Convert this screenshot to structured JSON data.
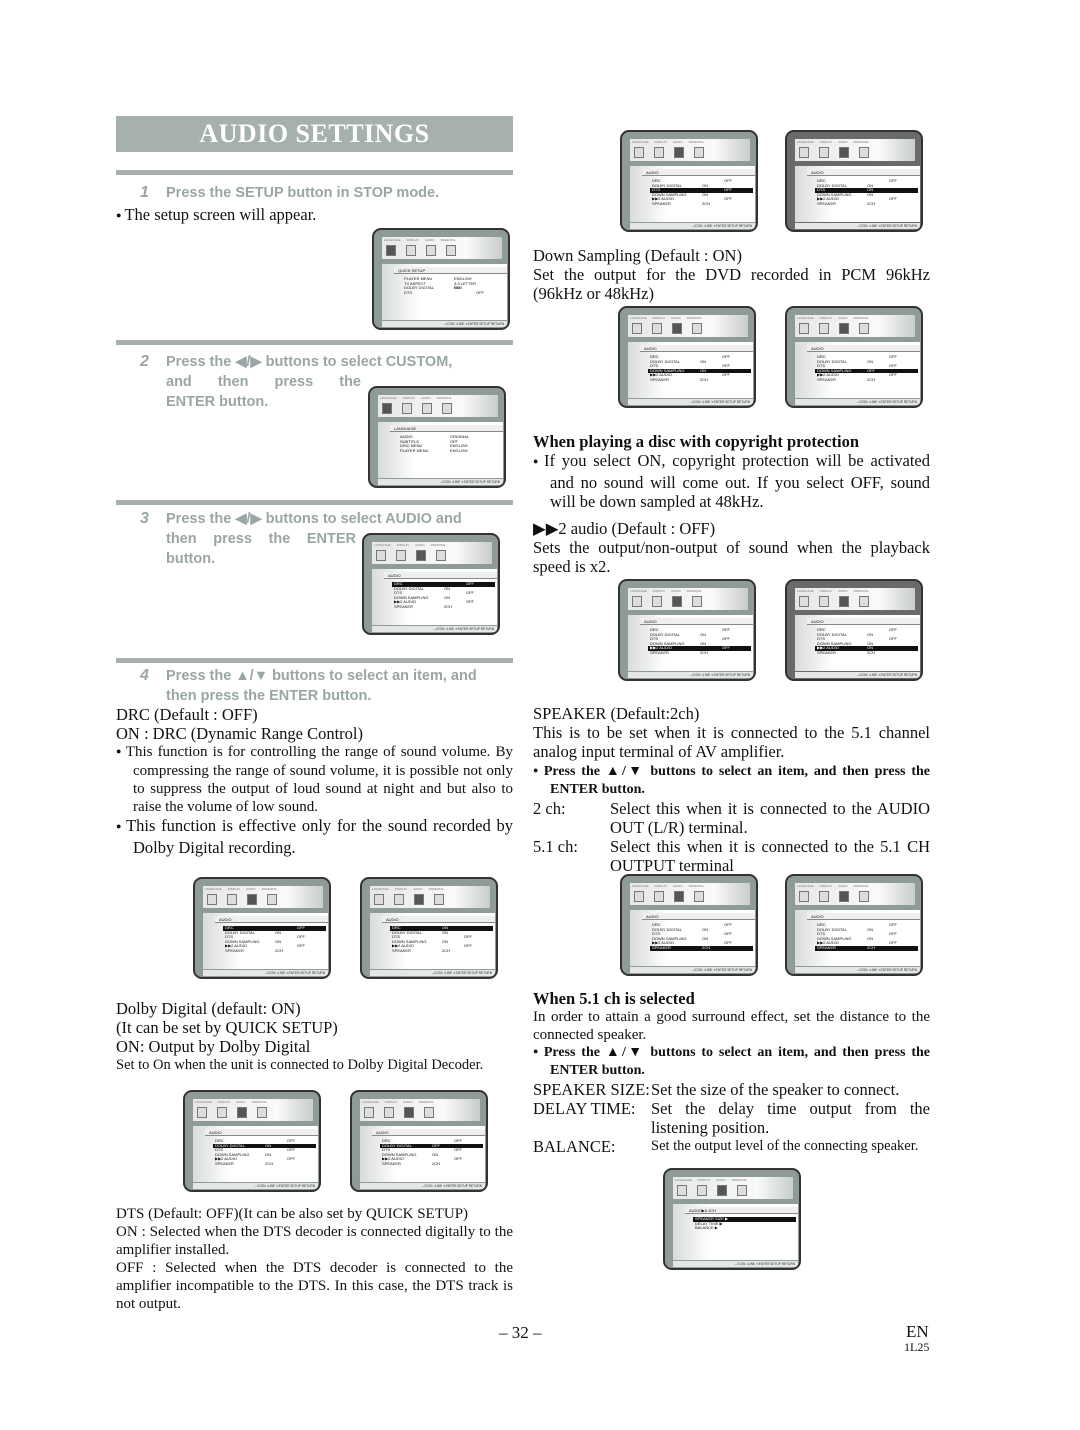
{
  "title": "AUDIO SETTINGS",
  "steps": [
    {
      "num": "1",
      "text": "Press the SETUP button in STOP mode."
    },
    {
      "num": "2",
      "line1": "Press the ◀/▶ buttons to select CUSTOM,",
      "line2": "and then press the",
      "line3": "ENTER button."
    },
    {
      "num": "3",
      "line1": "Press the ◀/▶ buttons to select AUDIO and",
      "line2": "then press the ENTER",
      "line3": "button."
    },
    {
      "num": "4",
      "line1": "Press the ▲/▼ buttons to select an item, and",
      "line2": "then press the ENTER button."
    }
  ],
  "left": {
    "setup_appear": "The setup screen will appear.",
    "drc_default": "DRC (Default : OFF)",
    "drc_on": "ON : DRC (Dynamic Range Control)",
    "drc_bullet1": "This function is for controlling the range of sound volume. By compressing the range of sound volume, it is possible not only to suppress the output of loud sound at night and but also to raise the volume of low sound.",
    "drc_bullet2": "This function is effective only for the sound recorded by Dolby Digital recording.",
    "dolby_default": "Dolby Digital (default: ON)",
    "dolby_quick": "(It can be set by QUICK SETUP)",
    "dolby_on": "ON: Output by Dolby Digital",
    "dolby_note": "Set to On when the unit is connected to Dolby Digital Decoder.",
    "dts_default": "DTS (Default: OFF)(It can be also set by QUICK SETUP)",
    "dts_on": "ON : Selected when the DTS decoder is connected digitally to the amplifier installed.",
    "dts_off": "OFF : Selected when the DTS decoder is connected to the amplifier incompatible to the DTS. In this case, the DTS track is not output."
  },
  "right": {
    "ds_default": "Down Sampling (Default : ON)",
    "ds_desc": "Set the output for the DVD recorded in PCM 96kHz (96kHz or 48kHz)",
    "copyright_head": "When playing a disc with copyright protection",
    "copyright_bullet": "If you select ON, copyright protection will be activated and no sound will come out. If you select OFF, sound will be down sampled at 48kHz.",
    "x2_default": "▶▶2 audio (Default : OFF)",
    "x2_desc": "Sets the output/non-output of sound when the playback speed is x2.",
    "speaker_default": "SPEAKER (Default:2ch)",
    "speaker_desc": "This is to be set when it is connected to the 5.1 channel analog input terminal of AV amplifier.",
    "speaker_bullet": "Press the ▲/▼ buttons to select an item, and then press the ENTER button.",
    "ch2_label": "2 ch:",
    "ch2_desc": "Select this when it is connected to the AUDIO OUT (L/R) terminal.",
    "ch51_label": "5.1 ch:",
    "ch51_desc": "Select this when it is connected to the 5.1 CH OUTPUT terminal",
    "ch51_head": "When 5.1 ch is selected",
    "ch51_intro": "In order to attain a good surround effect, set the distance to the connected speaker.",
    "ch51_bullet": "Press the ▲/▼ buttons to select an item, and then press the ENTER button.",
    "size_label": "SPEAKER SIZE:",
    "size_desc": "Set the size of the speaker to connect.",
    "delay_label": "DELAY TIME:",
    "delay_desc": "Set the delay time output from the listening position.",
    "balance_label": "BALANCE:",
    "balance_desc": "Set the output level of the connecting speaker."
  },
  "screen": {
    "tabs": [
      "LANGUAGE",
      "DISPLAY",
      "AUDIO",
      "PARENTAL"
    ],
    "footer": "↔ICON ↕LINE ✦ENTER SETUP RETURN",
    "quick": {
      "header": "QUICK SETUP",
      "rows": [
        [
          "PLAYER MENU",
          "ENGLISH",
          ""
        ],
        [
          "TV ASPECT",
          "4:3 LETTER BOX",
          ""
        ],
        [
          "DOLBY DIGITAL",
          "ON",
          ""
        ],
        [
          "DTS",
          "",
          "OFF"
        ]
      ]
    },
    "language": {
      "header": "LANGUAGE",
      "rows": [
        [
          "AUDIO",
          "ORIGINAL",
          ""
        ],
        [
          "SUBTITLE",
          "OFF",
          ""
        ],
        [
          "DISC MENU",
          "ENGLISH",
          ""
        ],
        [
          "PLAYER MENU",
          "ENGLISH",
          ""
        ]
      ]
    },
    "audio_header": "AUDIO",
    "audio_rows": [
      [
        "DRC",
        "",
        "OFF"
      ],
      [
        "DOLBY DIGITAL",
        "ON",
        ""
      ],
      [
        "DTS",
        "",
        "OFF"
      ],
      [
        "DOWN SAMPLING",
        "ON",
        ""
      ],
      [
        "▶▶2 AUDIO",
        "",
        "OFF"
      ],
      [
        "SPEAKER",
        "2CH",
        ""
      ]
    ],
    "ch51": {
      "header": "AUDIO▶5.1CH",
      "rows": [
        [
          "SPEAKER SIZE ▶",
          "",
          ""
        ],
        [
          "DELAY TIME ▶",
          "",
          ""
        ],
        [
          "BALANCE ▶",
          "",
          ""
        ]
      ]
    }
  },
  "footer": {
    "page": "– 32 –",
    "lang": "EN",
    "code": "1L25"
  }
}
